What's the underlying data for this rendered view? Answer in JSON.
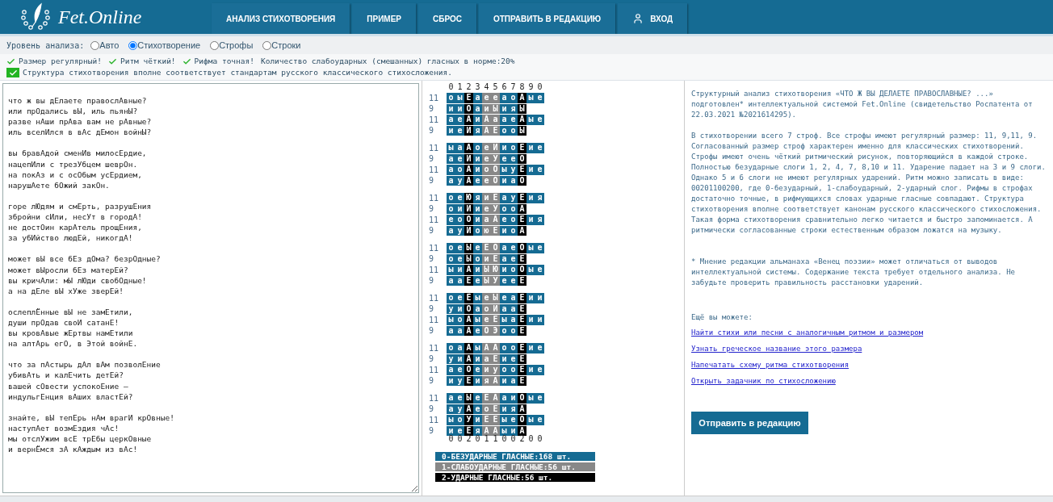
{
  "header": {
    "brand": "Fet.Online",
    "nav": [
      {
        "label": "АНАЛИЗ СТИХОТВОРЕНИЯ",
        "kind": "text"
      },
      {
        "label": "ПРИМЕР",
        "kind": "text"
      },
      {
        "label": "СБРОС",
        "kind": "text"
      },
      {
        "label": "ОТПРАВИТЬ В РЕДАКЦИЮ",
        "kind": "text"
      },
      {
        "label": "ВХОД",
        "kind": "user"
      }
    ]
  },
  "analysis_level": {
    "label": "Уровень анализа:",
    "options": [
      {
        "label": "Авто",
        "selected": false
      },
      {
        "label": "Стихотворение",
        "selected": true
      },
      {
        "label": "Строфы",
        "selected": false
      },
      {
        "label": "Строки",
        "selected": false
      }
    ]
  },
  "status_lines": [
    [
      {
        "kind": "check",
        "text": "Размер регулярный!"
      },
      {
        "kind": "check",
        "text": "Ритм чёткий!"
      },
      {
        "kind": "check",
        "text": "Рифма точная!"
      },
      {
        "kind": "plain",
        "text": "Количество слабоударных (смешанных) гласных в норме:20%"
      }
    ],
    [
      {
        "kind": "box",
        "text": "Структура стихотворения вполне соответствует стандартам русского классического стихосложения."
      }
    ]
  ],
  "poem": [
    [
      "что ж вы дЕлаете правослАвные?",
      "или прОдались вЫ, иль пьянЫ?",
      "разве нАши прАва вам не рАвные?",
      "иль вселИлся в вАс дЕмон войнЫ?"
    ],
    [
      "вы бравАдой сменИв милосЕрдие,",
      "нацепИли с трезУбцем шеврОн.",
      "на покАз и с осОбым усЕрдием,",
      "нарушАете бОжий закОн."
    ],
    [
      "горе лЮдям и смЕрть, разрушЕния",
      "збройни сИли, несУт в городА!",
      "не достОин карАтель прощЕния,",
      "за убИйство людЕй, никогдА!"
    ],
    [
      "может вЫ все бЕз дОма? безрОдные?",
      "может вЫросли бЕз матерЕй?",
      "вы кричАли: мЫ лЮди свобОдные!",
      "а на дЕле вЫ хУже зверЕй!"
    ],
    [
      "ослеплЁнные вЫ не замЕтили,",
      "души прОдав своИ сатанЕ!",
      "вы кровАвые жЕртвы намЕтили",
      "на алтАрь егО, в Этой войнЕ."
    ],
    [
      "что за пАстырь дАл вАм позволЕние",
      "убивАть и калЕчить детЕй?",
      "вашей сОвести успокоЕние –",
      "индульгЕнция вАших властЕй?"
    ],
    [
      "знайте, вЫ тепЕрь нАм врагИ крОвные!",
      "наступАет возмЕздия чАс!",
      "мы отслУжим всЕ трЕбы церкОвные",
      "и вернЁмся зА кАждым из вАс!"
    ]
  ],
  "scheme": {
    "columns": [
      {
        "header": "0",
        "footer": "0",
        "kind": "unstressed"
      },
      {
        "header": "1",
        "footer": "0",
        "kind": "unstressed"
      },
      {
        "header": "2",
        "footer": "2",
        "kind": "stressed"
      },
      {
        "header": "3",
        "footer": "0",
        "kind": "unstressed"
      },
      {
        "header": "4",
        "footer": "1",
        "kind": "weak"
      },
      {
        "header": "5",
        "footer": "1",
        "kind": "weak"
      },
      {
        "header": "6",
        "footer": "0",
        "kind": "unstressed"
      },
      {
        "header": "7",
        "footer": "0",
        "kind": "unstressed"
      },
      {
        "header": "8",
        "footer": "2",
        "kind": "stressed"
      },
      {
        "header": "9",
        "footer": "0",
        "kind": "unstressed"
      },
      {
        "header": "0",
        "footer": "0",
        "kind": "unstressed"
      }
    ],
    "stanzas": [
      [
        {
          "count": "11",
          "vowels": [
            "о",
            "ы",
            "Е",
            "а",
            "е",
            "е",
            "а",
            "о",
            "А",
            "ы",
            "е"
          ]
        },
        {
          "count": "9",
          "vowels": [
            "и",
            "и",
            "О",
            "а",
            "и",
            "Ы",
            "и",
            "я",
            "Ы"
          ]
        },
        {
          "count": "11",
          "vowels": [
            "а",
            "е",
            "А",
            "и",
            "А",
            "а",
            "а",
            "е",
            "А",
            "ы",
            "е"
          ]
        },
        {
          "count": "9",
          "vowels": [
            "и",
            "е",
            "И",
            "я",
            "А",
            "Е",
            "о",
            "о",
            "Ы"
          ]
        }
      ],
      [
        {
          "count": "11",
          "vowels": [
            "ы",
            "а",
            "А",
            "о",
            "е",
            "И",
            "и",
            "о",
            "Е",
            "и",
            "е"
          ]
        },
        {
          "count": "9",
          "vowels": [
            "а",
            "е",
            "И",
            "и",
            "е",
            "У",
            "е",
            "е",
            "О"
          ]
        },
        {
          "count": "11",
          "vowels": [
            "а",
            "о",
            "А",
            "и",
            "о",
            "О",
            "ы",
            "у",
            "Е",
            "и",
            "е"
          ]
        },
        {
          "count": "9",
          "vowels": [
            "а",
            "у",
            "А",
            "е",
            "е",
            "О",
            "и",
            "а",
            "О"
          ]
        }
      ],
      [
        {
          "count": "11",
          "vowels": [
            "о",
            "е",
            "Ю",
            "я",
            "и",
            "Е",
            "а",
            "у",
            "Е",
            "и",
            "я"
          ]
        },
        {
          "count": "9",
          "vowels": [
            "о",
            "и",
            "И",
            "и",
            "е",
            "У",
            "о",
            "о",
            "А"
          ]
        },
        {
          "count": "11",
          "vowels": [
            "е",
            "о",
            "О",
            "и",
            "а",
            "А",
            "е",
            "о",
            "Е",
            "и",
            "я"
          ]
        },
        {
          "count": "9",
          "vowels": [
            "а",
            "у",
            "И",
            "о",
            "ю",
            "Е",
            "и",
            "о",
            "А"
          ]
        }
      ],
      [
        {
          "count": "11",
          "vowels": [
            "о",
            "е",
            "Ы",
            "е",
            "Е",
            "О",
            "а",
            "е",
            "О",
            "ы",
            "е"
          ]
        },
        {
          "count": "9",
          "vowels": [
            "о",
            "е",
            "Ы",
            "о",
            "и",
            "Е",
            "а",
            "е",
            "Е"
          ]
        },
        {
          "count": "11",
          "vowels": [
            "ы",
            "и",
            "А",
            "и",
            "Ы",
            "Ю",
            "и",
            "о",
            "О",
            "ы",
            "е"
          ]
        },
        {
          "count": "9",
          "vowels": [
            "а",
            "а",
            "Е",
            "е",
            "Ы",
            "У",
            "е",
            "е",
            "Е"
          ]
        }
      ],
      [
        {
          "count": "11",
          "vowels": [
            "о",
            "е",
            "Ё",
            "ы",
            "е",
            "Ы",
            "е",
            "а",
            "Е",
            "и",
            "и"
          ]
        },
        {
          "count": "9",
          "vowels": [
            "у",
            "и",
            "О",
            "а",
            "о",
            "И",
            "а",
            "а",
            "Е"
          ]
        },
        {
          "count": "11",
          "vowels": [
            "ы",
            "о",
            "А",
            "ы",
            "е",
            "Е",
            "ы",
            "а",
            "Е",
            "и",
            "и"
          ]
        },
        {
          "count": "9",
          "vowels": [
            "а",
            "а",
            "А",
            "е",
            "О",
            "Э",
            "о",
            "о",
            "Е"
          ]
        }
      ],
      [
        {
          "count": "11",
          "vowels": [
            "о",
            "а",
            "А",
            "ы",
            "А",
            "А",
            "о",
            "о",
            "Е",
            "и",
            "е"
          ]
        },
        {
          "count": "9",
          "vowels": [
            "у",
            "и",
            "А",
            "и",
            "а",
            "Е",
            "и",
            "е",
            "Е"
          ]
        },
        {
          "count": "11",
          "vowels": [
            "а",
            "е",
            "О",
            "е",
            "и",
            "у",
            "о",
            "о",
            "Е",
            "и",
            "е"
          ]
        },
        {
          "count": "9",
          "vowels": [
            "и",
            "у",
            "Е",
            "и",
            "я",
            "А",
            "и",
            "а",
            "Е"
          ]
        }
      ],
      [
        {
          "count": "11",
          "vowels": [
            "а",
            "е",
            "Ы",
            "е",
            "Е",
            "А",
            "а",
            "и",
            "О",
            "ы",
            "е"
          ]
        },
        {
          "count": "9",
          "vowels": [
            "а",
            "у",
            "А",
            "е",
            "о",
            "Е",
            "и",
            "я",
            "А"
          ]
        },
        {
          "count": "11",
          "vowels": [
            "ы",
            "о",
            "У",
            "и",
            "Е",
            "Е",
            "ы",
            "е",
            "О",
            "ы",
            "е"
          ]
        },
        {
          "count": "9",
          "vowels": [
            "и",
            "е",
            "Ё",
            "я",
            "А",
            "А",
            "ы",
            "и",
            "А"
          ]
        }
      ]
    ],
    "legend": [
      {
        "kind": "unstressed",
        "text": "0-БЕЗУДАРНЫЕ ГЛАСНЫЕ:168 шт."
      },
      {
        "kind": "weak",
        "text": "1-СЛАБОУДАРНЫЕ ГЛАСНЫЕ:56 шт."
      },
      {
        "kind": "stressed",
        "text": "2-УДАРНЫЕ ГЛАСНЫЕ:56 шт."
      }
    ]
  },
  "report": {
    "paragraphs": [
      "Структурный анализ стихотворения «ЧТО Ж ВЫ ДЕЛАЕТЕ ПРАВОСЛАВНЫЕ? ...» подготовлен* интеллектуальной системой Fet.Online (свидетельство Роспатента от 22.03.2021 №2021614295).",
      "В стихотворении всего 7 строф. Все строфы имеют регулярный размер: 11, 9,11, 9. Согласованный размер строф характерен именно для классических стихотворений. Строфы имеют очень чёткий ритмический рисунок, повторяющийся в каждой строке. Полностью безударные слоги 1, 2, 4, 7, 8,10 и 11. Ударение падает на 3 и 9 слоги. Однако 5 и 6 слоги не имеют регулярных ударений. Ритм можно записать в виде: 00201100200, где 0-безударный, 1-слабоударный, 2-ударный слог. Рифмы в строфах достаточно точные, в рифмующихся словах ударные гласные совпадают. Структура стихотворения вполне соответствует канонам русского классического стихосложения. Такая форма стихотворения сравнительно легко читается и быстро запоминается. А ритмически согласованные строки естественным образом ложатся на музыку."
    ],
    "footnote": "* Мнение редакции альманаха «Венец поэзии» может отличаться от выводов интеллектуальной системы. Содержание текста требует отдельного анализа. Не забудьте проверить правильность расстановки ударений.",
    "more_label": "Ещё вы можете:",
    "links": [
      "Найти стихи или песни с аналогичным ритмом и размером",
      "Узнать греческое название этого размера",
      "Напечатать схему ритма стихотворения",
      "Открыть задачник по стихосложению"
    ],
    "button": "Отправить в редакцию"
  }
}
